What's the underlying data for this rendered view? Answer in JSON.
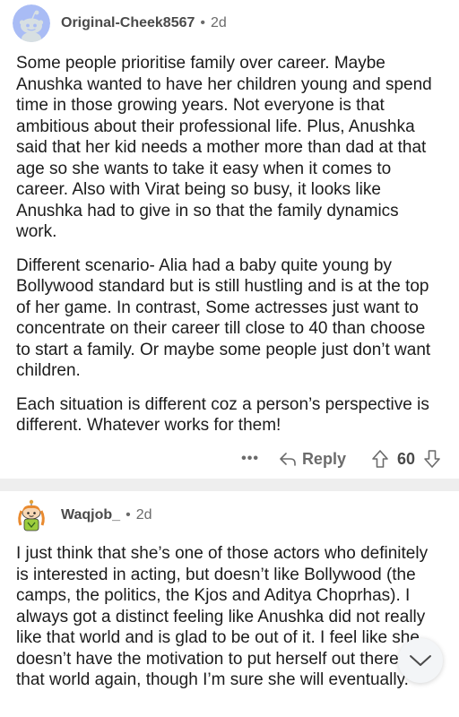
{
  "comments": [
    {
      "username": "Original-Cheek8567",
      "separator": "•",
      "age": "2d",
      "paragraphs": [
        "Some people prioritise family over career. Maybe Anushka wanted to have her children young and spend time in those growing years. Not everyone is that ambitious about their professional life. Plus, Anushka said that her kid needs a mother more than dad at that age so she wants to take it easy when it comes to career. Also with Virat being so busy, it looks like Anushka had to give in so that the family dynamics work.",
        "Different scenario- Alia had a baby quite young by Bollywood standard but is still hustling and is at the top of her game. In contrast, Some actresses just want to concentrate on their career till close to 40 than choose to start a family. Or maybe some people just don’t want children.",
        "Each situation is different coz a person’s perspective is different. Whatever works for them!"
      ],
      "more_label": "•••",
      "reply_label": "Reply",
      "score": "60",
      "avatar_icon": "reddit-snoo-avatar-icon"
    },
    {
      "username": "Waqjob_",
      "separator": "•",
      "age": "2d",
      "paragraphs": [
        "I just think that she’s one of those actors who definitely is interested in acting, but doesn’t like Bollywood (the camps, the politics, the Kjos and Aditya Choprhas). I always got a distinct feeling like Anushka did not really like that world and is glad to be out of it. I feel like she doesn’t have the motivation to put herself out there in that world again, though I’m sure she will eventually."
      ],
      "avatar_icon": "custom-snoo-avatar-icon"
    }
  ],
  "scroll_button_icon": "chevron-down-icon",
  "colors": {
    "text": "#1c1c1c",
    "meta": "#6b6b6b",
    "separator": "#eeeeee",
    "avatar_bg": "#a9bcf5"
  }
}
